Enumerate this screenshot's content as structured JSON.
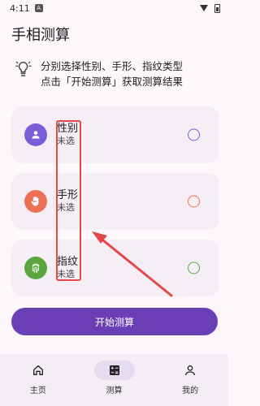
{
  "status_bar": {
    "time": "4:11",
    "notification_icon": "A"
  },
  "app_bar": {
    "title": "手相测算"
  },
  "tip": {
    "icon": "lightbulb-icon",
    "line1": "分别选择性别、手形、指纹类型",
    "line2": "点击「开始测算」获取测算结果"
  },
  "options": [
    {
      "title": "性别",
      "status": "未选",
      "icon": "person-icon",
      "color": "#7a5ed8"
    },
    {
      "title": "手形",
      "status": "未选",
      "icon": "hand-icon",
      "color": "#ee6f57"
    },
    {
      "title": "指纹",
      "status": "未选",
      "icon": "fingerprint-icon",
      "color": "#5aa540"
    }
  ],
  "start_button": {
    "label": "开始测算"
  },
  "bottom_nav": [
    {
      "label": "主页",
      "icon": "home-icon",
      "active": false
    },
    {
      "label": "测算",
      "icon": "calculator-icon",
      "active": true
    },
    {
      "label": "我的",
      "icon": "profile-icon",
      "active": false
    }
  ],
  "colors": {
    "primary": "#6a3fb5",
    "annotation": "#e54848"
  }
}
